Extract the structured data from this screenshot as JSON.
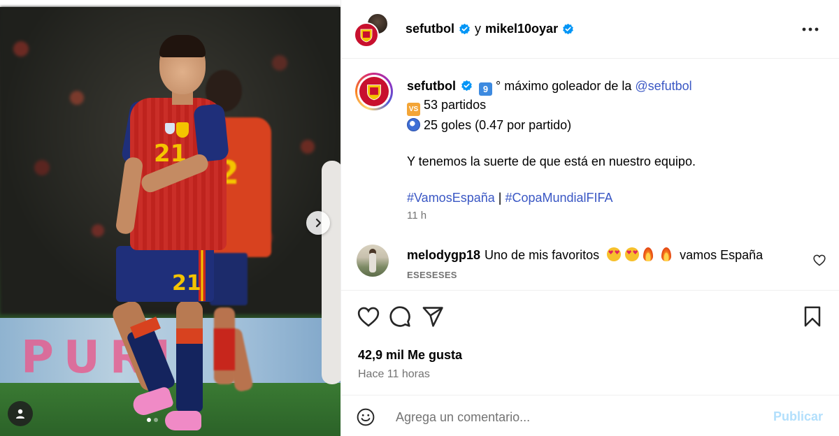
{
  "header": {
    "user1": "sefutbol",
    "conjunction": "y",
    "user2": "mikel10oyar"
  },
  "caption": {
    "username": "sefutbol",
    "emoji_rank": "9",
    "line1": "° máximo goleador de la ",
    "mention": "@sefutbol",
    "emoji_vs": "VS",
    "line2": "53 partidos",
    "line3": "25 goles (0.47 por partido)",
    "line4": "Y tenemos la suerte de que está en nuestro equipo.",
    "hashtag1": "#VamosEspaña",
    "separator": "|",
    "hashtag2": "#CopaMundialFIFA",
    "time": "11 h"
  },
  "comment": {
    "username": "melodygp18",
    "text_before": "Uno de mis favoritos",
    "text_after": "vamos España",
    "reply_label": "ESESESES"
  },
  "stats": {
    "likes": "42,9 mil Me gusta",
    "time_ago": "Hace 11 horas"
  },
  "add_comment": {
    "placeholder": "Agrega un comentario...",
    "publish": "Publicar"
  },
  "photo": {
    "shirt_number": "21",
    "shorts_number": "21",
    "back_player_number": "2",
    "board_text": "PURI"
  },
  "colors": {
    "verified": "#0095f6",
    "link": "#3a57c4",
    "publish_disabled": "#b2dffc",
    "secondary_text": "#737373"
  },
  "icons": [
    "verified-badge-icon",
    "more-options-icon",
    "heart-icon",
    "comment-icon",
    "share-icon",
    "bookmark-icon",
    "emoji-icon",
    "next-arrow-icon",
    "tagged-user-icon"
  ]
}
